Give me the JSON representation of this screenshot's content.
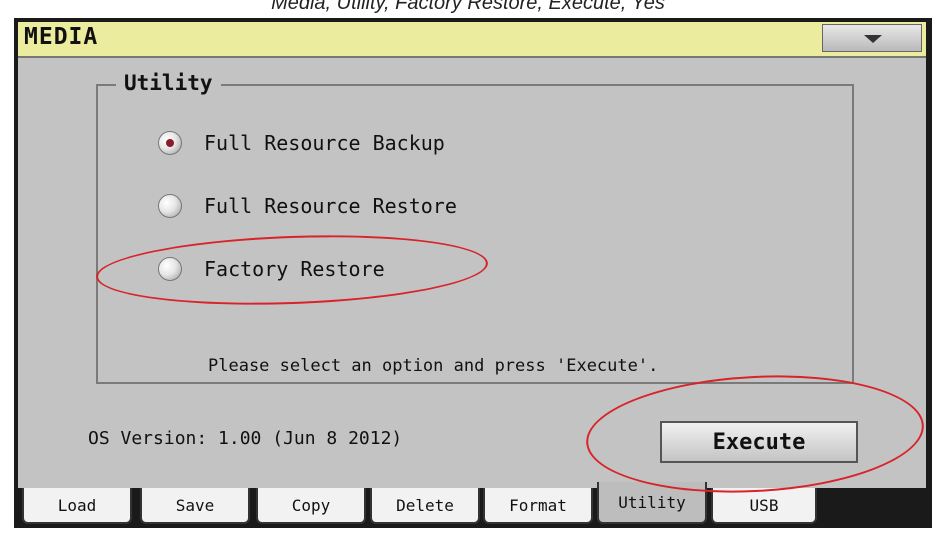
{
  "caption": "Media, Utility, Factory Restore, Execute, Yes",
  "window": {
    "title": "MEDIA"
  },
  "group": {
    "label": "Utility"
  },
  "options": [
    {
      "label": "Full Resource Backup",
      "selected": true
    },
    {
      "label": "Full Resource Restore",
      "selected": false
    },
    {
      "label": "Factory Restore",
      "selected": false
    }
  ],
  "hint": "Please select an option and press 'Execute'.",
  "os_version": "OS Version: 1.00 (Jun  8 2012)",
  "execute_label": "Execute",
  "tabs": [
    {
      "label": "Load",
      "active": false
    },
    {
      "label": "Save",
      "active": false
    },
    {
      "label": "Copy",
      "active": false
    },
    {
      "label": "Delete",
      "active": false
    },
    {
      "label": "Format",
      "active": false
    },
    {
      "label": "Utility",
      "active": true
    },
    {
      "label": "USB",
      "active": false
    }
  ],
  "colors": {
    "accent_radio": "#8b1a2a",
    "titlebar": "#ecec9e",
    "panel": "#c3c3c3",
    "annotation": "#d8232a"
  }
}
